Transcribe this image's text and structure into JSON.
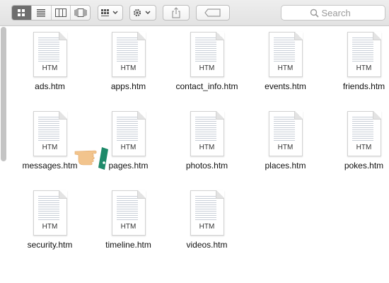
{
  "toolbar": {
    "view_modes": [
      "icon-view",
      "list-view",
      "column-view",
      "cover-flow-view"
    ],
    "search": {
      "placeholder": "Search"
    }
  },
  "files": [
    {
      "name": "ads.htm",
      "ext": "HTM"
    },
    {
      "name": "apps.htm",
      "ext": "HTM"
    },
    {
      "name": "contact_info.htm",
      "ext": "HTM"
    },
    {
      "name": "events.htm",
      "ext": "HTM"
    },
    {
      "name": "friends.htm",
      "ext": "HTM"
    },
    {
      "name": "messages.htm",
      "ext": "HTM"
    },
    {
      "name": "pages.htm",
      "ext": "HTM"
    },
    {
      "name": "photos.htm",
      "ext": "HTM"
    },
    {
      "name": "places.htm",
      "ext": "HTM"
    },
    {
      "name": "pokes.htm",
      "ext": "HTM"
    },
    {
      "name": "security.htm",
      "ext": "HTM"
    },
    {
      "name": "timeline.htm",
      "ext": "HTM"
    },
    {
      "name": "videos.htm",
      "ext": "HTM"
    }
  ],
  "colors": {
    "toolbar_bg": "#e6e6e6",
    "active_segment": "#6e6e6e",
    "hand_cursor": "#f2c48d",
    "cursor_sleeve": "#1e8a6a"
  }
}
